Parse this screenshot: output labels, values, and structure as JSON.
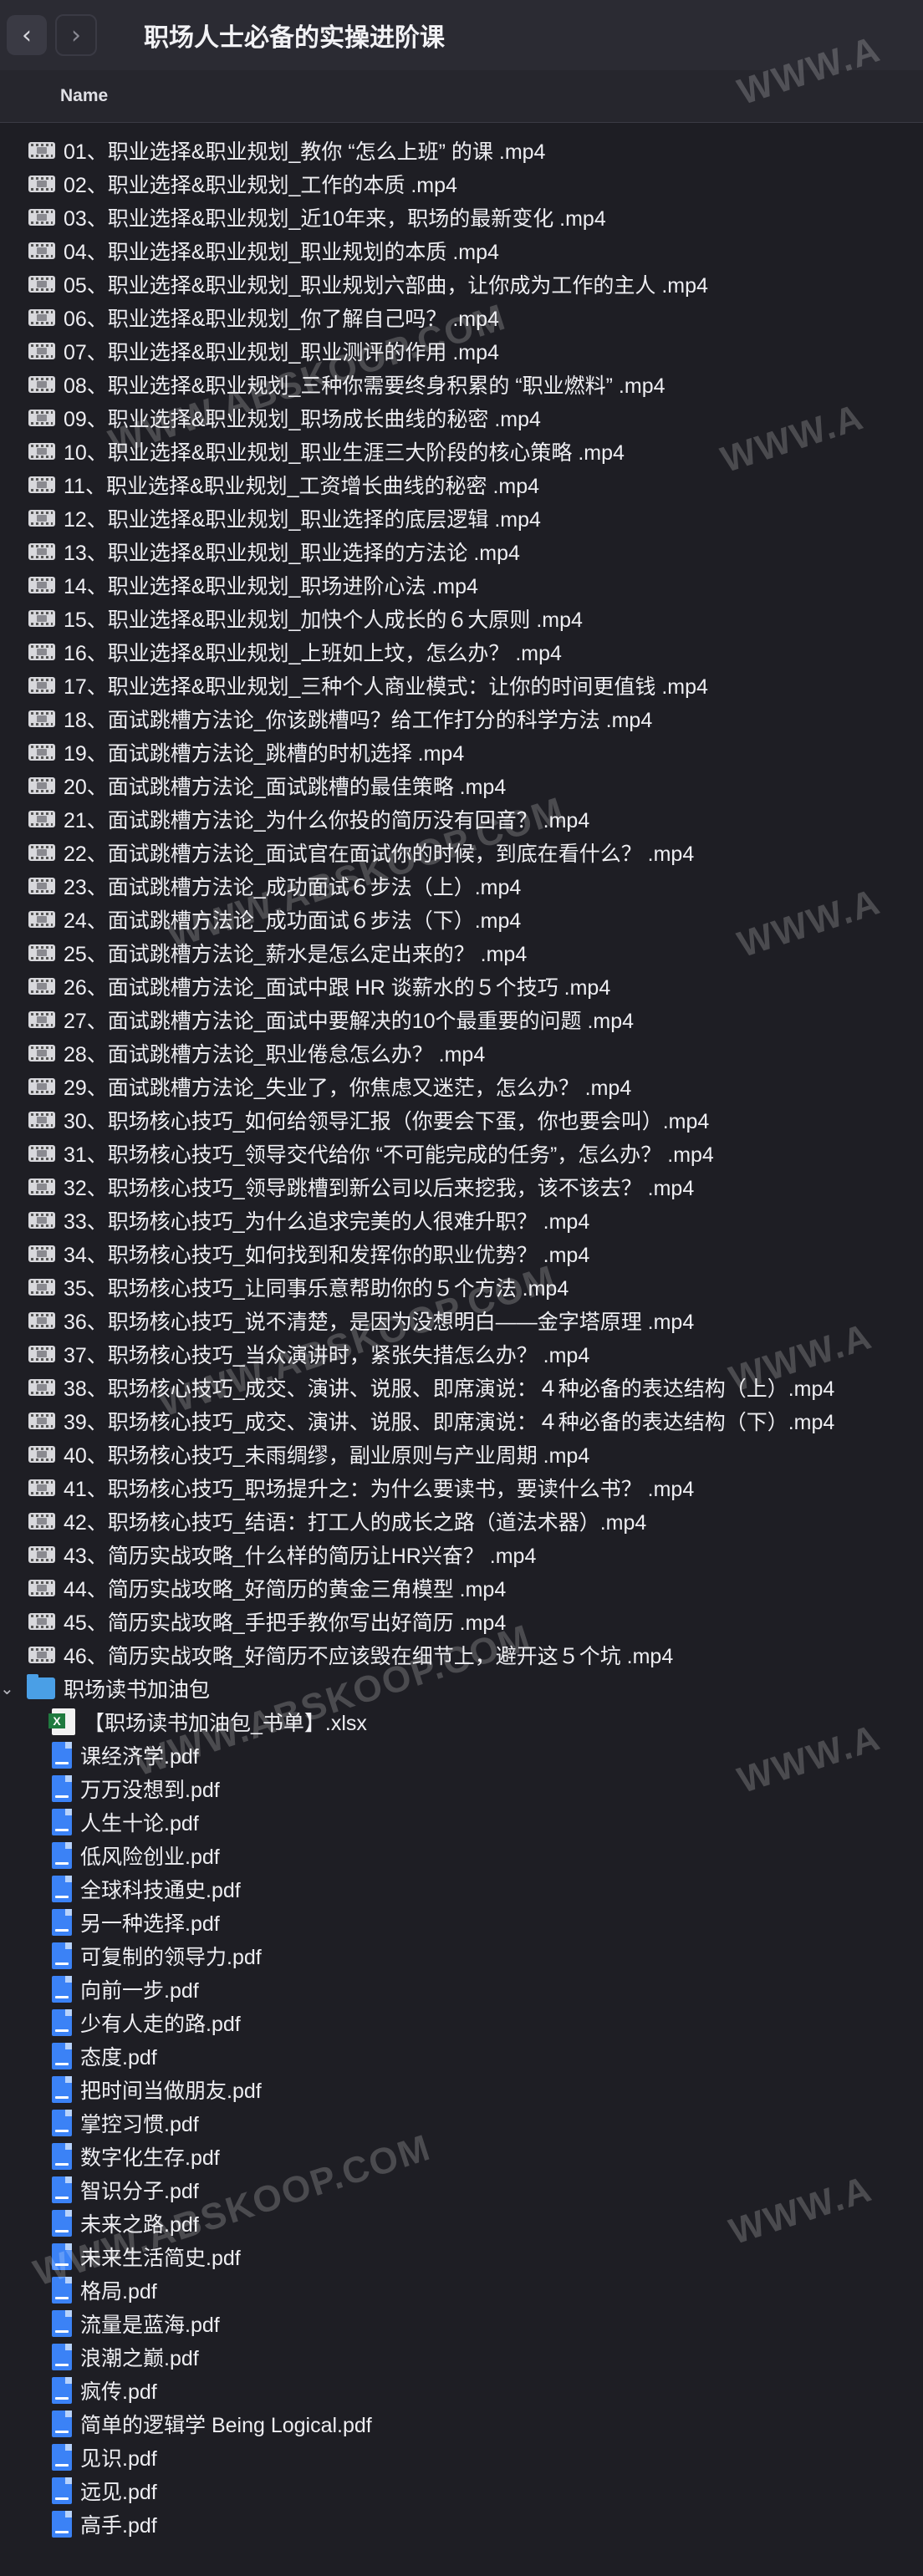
{
  "window": {
    "title": "职场人士必备的实操进阶课",
    "back_glyph": "‹",
    "forward_glyph": "›"
  },
  "header": {
    "name_column": "Name"
  },
  "videos": [
    "01、职业选择&职业规划_教你 “怎么上班” 的课 .mp4",
    "02、职业选择&职业规划_工作的本质 .mp4",
    "03、职业选择&职业规划_近10年来，职场的最新变化 .mp4",
    "04、职业选择&职业规划_职业规划的本质 .mp4",
    "05、职业选择&职业规划_职业规划六部曲，让你成为工作的主人 .mp4",
    "06、职业选择&职业规划_你了解自己吗？ .mp4",
    "07、职业选择&职业规划_职业测评的作用 .mp4",
    "08、职业选择&职业规划_三种你需要终身积累的 “职业燃料” .mp4",
    "09、职业选择&职业规划_职场成长曲线的秘密 .mp4",
    "10、职业选择&职业规划_职业生涯三大阶段的核心策略 .mp4",
    "11、职业选择&职业规划_工资增长曲线的秘密 .mp4",
    "12、职业选择&职业规划_职业选择的底层逻辑 .mp4",
    "13、职业选择&职业规划_职业选择的方法论 .mp4",
    "14、职业选择&职业规划_职场进阶心法 .mp4",
    "15、职业选择&职业规划_加快个人成长的６大原则 .mp4",
    "16、职业选择&职业规划_上班如上坟，怎么办？ .mp4",
    "17、职业选择&职业规划_三种个人商业模式：让你的时间更值钱 .mp4",
    "18、面试跳槽方法论_你该跳槽吗？给工作打分的科学方法 .mp4",
    "19、面试跳槽方法论_跳槽的时机选择 .mp4",
    "20、面试跳槽方法论_面试跳槽的最佳策略 .mp4",
    "21、面试跳槽方法论_为什么你投的简历没有回音？ .mp4",
    "22、面试跳槽方法论_面试官在面试你的时候，到底在看什么？ .mp4",
    "23、面试跳槽方法论_成功面试６步法（上）.mp4",
    "24、面试跳槽方法论_成功面试６步法（下）.mp4",
    "25、面试跳槽方法论_薪水是怎么定出来的？ .mp4",
    "26、面试跳槽方法论_面试中跟 HR 谈薪水的５个技巧 .mp4",
    "27、面试跳槽方法论_面试中要解决的10个最重要的问题 .mp4",
    "28、面试跳槽方法论_职业倦怠怎么办？ .mp4",
    "29、面试跳槽方法论_失业了，你焦虑又迷茫，怎么办？ .mp4",
    "30、职场核心技巧_如何给领导汇报（你要会下蛋，你也要会叫）.mp4",
    "31、职场核心技巧_领导交代给你 “不可能完成的任务”，怎么办？ .mp4",
    "32、职场核心技巧_领导跳槽到新公司以后来挖我，该不该去？ .mp4",
    "33、职场核心技巧_为什么追求完美的人很难升职？ .mp4",
    "34、职场核心技巧_如何找到和发挥你的职业优势？ .mp4",
    "35、职场核心技巧_让同事乐意帮助你的５个方法 .mp4",
    "36、职场核心技巧_说不清楚，是因为没想明白——金字塔原理 .mp4",
    "37、职场核心技巧_当众演讲时，紧张失措怎么办？ .mp4",
    "38、职场核心技巧_成交、演讲、说服、即席演说：４种必备的表达结构（上）.mp4",
    "39、职场核心技巧_成交、演讲、说服、即席演说：４种必备的表达结构（下）.mp4",
    "40、职场核心技巧_未雨绸缪，副业原则与产业周期 .mp4",
    "41、职场核心技巧_职场提升之：为什么要读书，要读什么书？ .mp4",
    "42、职场核心技巧_结语：打工人的成长之路（道法术器）.mp4",
    "43、简历实战攻略_什么样的简历让HR兴奋？ .mp4",
    "44、简历实战攻略_好简历的黄金三角模型 .mp4",
    "45、简历实战攻略_手把手教你写出好简历 .mp4",
    "46、简历实战攻略_好简历不应该毁在细节上，避开这５个坑 .mp4"
  ],
  "folder": {
    "name": "职场读书加油包",
    "chevron": "⌄",
    "xlsx_badge": "X",
    "files": [
      {
        "type": "xlsx",
        "name": "【职场读书加油包_书单】.xlsx"
      },
      {
        "type": "pdf",
        "name": "课经济学.pdf"
      },
      {
        "type": "pdf",
        "name": "万万没想到.pdf"
      },
      {
        "type": "pdf",
        "name": "人生十论.pdf"
      },
      {
        "type": "pdf",
        "name": "低风险创业.pdf"
      },
      {
        "type": "pdf",
        "name": "全球科技通史.pdf"
      },
      {
        "type": "pdf",
        "name": "另一种选择.pdf"
      },
      {
        "type": "pdf",
        "name": "可复制的领导力.pdf"
      },
      {
        "type": "pdf",
        "name": "向前一步.pdf"
      },
      {
        "type": "pdf",
        "name": "少有人走的路.pdf"
      },
      {
        "type": "pdf",
        "name": "态度.pdf"
      },
      {
        "type": "pdf",
        "name": "把时间当做朋友.pdf"
      },
      {
        "type": "pdf",
        "name": "掌控习惯.pdf"
      },
      {
        "type": "pdf",
        "name": "数字化生存.pdf"
      },
      {
        "type": "pdf",
        "name": "智识分子.pdf"
      },
      {
        "type": "pdf",
        "name": "未来之路.pdf"
      },
      {
        "type": "pdf",
        "name": "未来生活简史.pdf"
      },
      {
        "type": "pdf",
        "name": "格局.pdf"
      },
      {
        "type": "pdf",
        "name": "流量是蓝海.pdf"
      },
      {
        "type": "pdf",
        "name": "浪潮之巅.pdf"
      },
      {
        "type": "pdf",
        "name": "疯传.pdf"
      },
      {
        "type": "pdf",
        "name": "简单的逻辑学 Being Logical.pdf"
      },
      {
        "type": "pdf",
        "name": "见识.pdf"
      },
      {
        "type": "pdf",
        "name": "远见.pdf"
      },
      {
        "type": "pdf",
        "name": "高手.pdf"
      }
    ]
  },
  "watermarks": [
    "WWW.ABSKOOP.COM",
    "WWW.ABSKOOP.COM",
    "WWW.A",
    "WWW.A",
    "WWW.ABSKOOP.COM",
    "WWW.A",
    "WWW.ABSKOOP.COM",
    "WWW.A",
    "WWW.ABSKOOP.COM",
    "WWW.A",
    "WWW.A"
  ]
}
